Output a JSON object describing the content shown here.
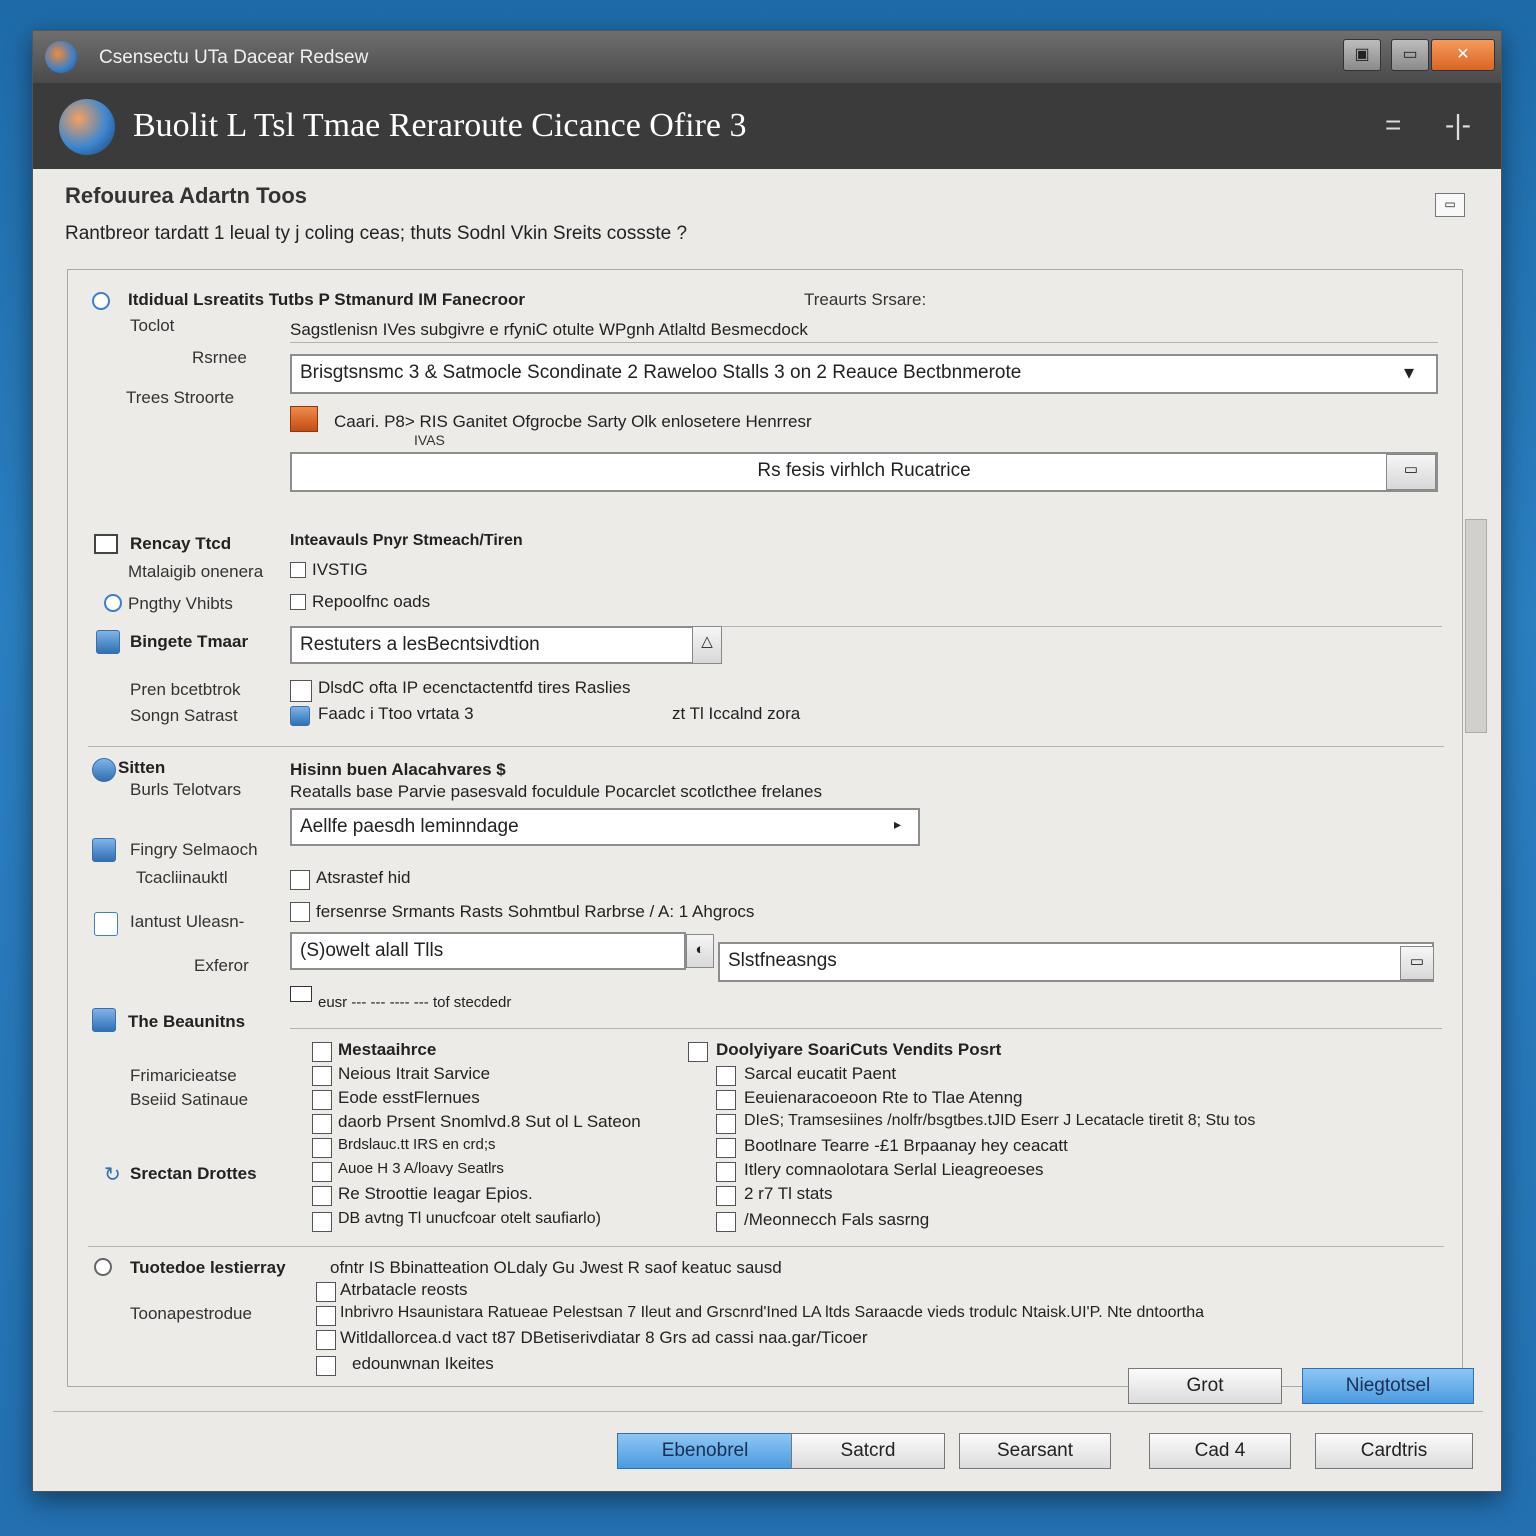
{
  "window": {
    "title": "Csensectu UTa Dacear Redsew",
    "buttons": [
      "▣",
      "▭",
      "✕"
    ]
  },
  "header": {
    "heading": "Buolit L Tsl Tmae Reraroute Cicance Ofire 3",
    "icons": [
      "=",
      "-|-"
    ]
  },
  "section": {
    "title": "Refouurea Adartn Toos",
    "description": "Rantbreor tardatt 1 leual ty j coling ceas; thuts Sodnl Vkin Sreits cossste ?"
  },
  "group1": {
    "heading": "Itdidual Lsreatits Tutbs P Stmanurd IM Fanecroor",
    "status": "Treaurts Srsare:",
    "labels": [
      "Toclot",
      "Rsrnee",
      "Trees Stroorte"
    ],
    "subline": "Sagstlenisn IVes subgivre e rfyniC otulte WPgnh Atlaltd Besmecdock",
    "select_value": "Brisgtsnsmc 3 & Satmocle Scondinate 2 Raweloo Stalls 3 on 2 Reauce Bectbnmerote",
    "option_line": "Caari. P8> RIS Ganitet Ofgrocbe Sarty Olk enlosetere Henrresr",
    "option_sub": "IVAS",
    "field2_value": "Rs fesis virhlch Rucatrice"
  },
  "group2": {
    "labels": [
      "Rencay Ttcd",
      "Mtalaigib onenera",
      "Pngthy Vhibts"
    ],
    "heading": "Inteavauls Pnyr Stmeach/Tiren",
    "checks": [
      "IVSTIG",
      "Repoolfnc oads"
    ]
  },
  "group3": {
    "labels": [
      "Bingete Tmaar",
      "Pren bcetbtrok",
      "Songn Satrast"
    ],
    "field_value": "Restuters a lesBecntsivdtion",
    "check1": "DlsdC ofta IP ecenctactentfd tires Raslies",
    "check2": "Faadc i Ttoo vrtata 3",
    "aside": "zt Tl Iccalnd zora"
  },
  "group4": {
    "labels": [
      "Sitten",
      "Burls Telotvars",
      "Fingry Selmaoch",
      "Tcacliinauktl",
      "Iantust Uleasn-",
      "Exferor"
    ],
    "heading": "Hisinn buen Alacahvares $",
    "subline": "Reatalls base Parvie pasesvald foculdule Pocarclet scotlcthee frelanes",
    "select_value": "Aellfe paesdh leminndage",
    "check1": "Atsrastef hid",
    "check2": "fersenrse Srmants Rasts Sohmtbul Rarbrse / A: 1 Ahgrocs",
    "field_left": "(S)owelt alall Tlls",
    "field_right": "Slstfneasngs",
    "dotted": "eusr --- --- ---- --- tof stecdedr"
  },
  "group5": {
    "labels": [
      "The Beaunitns",
      "Frimaricieatse Bseiid Satinaue",
      "Srectan Drottes"
    ],
    "left_items": [
      "Mestaaihrce",
      "Neious Itrait Sarvice",
      "Eode esstFlernues",
      "daorb Prsent Snomlvd.8 Sut ol L Sateon",
      "Brdslauc.tt IRS en crd;s",
      "Auoe H 3 A/loavy Seatlrs",
      "Re Stroottie Ieagar Epios.",
      "DB avtng Tl unucfcoar otelt saufiarlo)"
    ],
    "right_items": [
      "Doolyiyare SoariCuts Vendits Posrt",
      "Sarcal eucatit Paent",
      "Eeuienaracoeoon Rte to Tlae Atenng",
      "DIeS; Tramsesiines /nolfr/bsgtbes.tJID Eserr J Lecatacle tiretit 8; Stu tos",
      "Bootlnare Tearre -£1 Brpaanay hey ceacatt",
      "Itlery comnaolotara Serlal Lieagreoeses",
      "2 r7 Tl stats",
      "/Meonnecch Fals sasrng"
    ]
  },
  "group6": {
    "labels": [
      "Tuotedoe lestierray",
      "Toonapestrodue"
    ],
    "heading_tail": "ofntr IS Bbinatteation OLdaly Gu Jwest R saof keatuc sausd",
    "items": [
      "Atrbatacle reosts",
      "Inbrivro Hsaunistara Ratueae Pelestsan 7 Ileut and Grscnrd'Ined LA ltds Saraacde vieds trodulc Ntaisk.UI'P. Nte dntoortha",
      "Witldallorcea.d vact t87 DBetiserivdiatar 8 Grs ad cassi naa.gar/Ticoer",
      "edounwnan Ikeites"
    ],
    "buttons": [
      "Grot",
      "Niegtotsel"
    ]
  },
  "footer": {
    "buttons": [
      "Ebenobrel",
      "Satcrd",
      "Searsant",
      "Cad 4",
      "Cardtris"
    ]
  },
  "colors": {
    "desktop": "#236fb0",
    "accent": "#4a9be0",
    "title_bar": "#4a4a4a",
    "header": "#3b3b3b",
    "window": "#eceae6"
  }
}
